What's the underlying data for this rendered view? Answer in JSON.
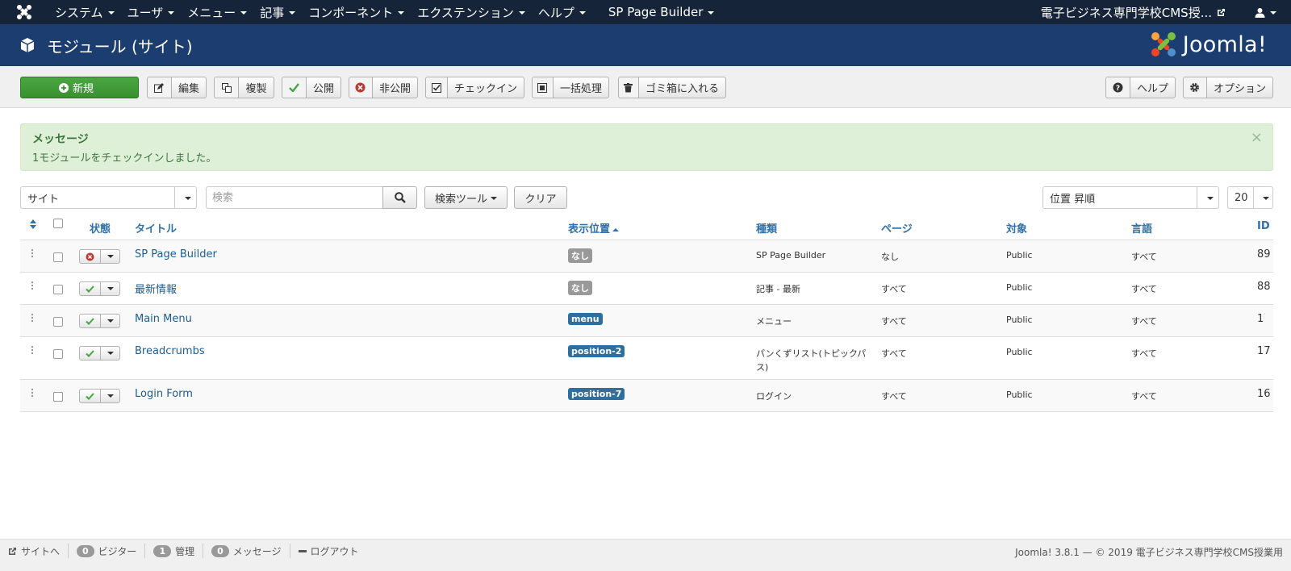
{
  "navbar": {
    "menu": [
      "システム",
      "ユーザ",
      "メニュー",
      "記事",
      "コンポーネント",
      "エクステンション",
      "ヘルプ",
      "SP Page Builder"
    ],
    "site_name": "電子ビジネス専門学校CMS授...",
    "icons": {
      "logo": "joomla-logo-icon",
      "external": "external-link-icon",
      "user": "user-icon"
    }
  },
  "header": {
    "title": "モジュール (サイト)",
    "logo_text": "Joomla!",
    "icons": {
      "title": "cube-icon"
    }
  },
  "toolbar": {
    "new_label": "新規",
    "edit_label": "編集",
    "copy_label": "複製",
    "publish_label": "公開",
    "unpublish_label": "非公開",
    "checkin_label": "チェックイン",
    "batch_label": "一括処理",
    "trash_label": "ゴミ箱に入れる",
    "help_label": "ヘルプ",
    "options_label": "オプション"
  },
  "alert": {
    "heading": "メッセージ",
    "message": "1モジュールをチェックインしました。",
    "close": "×"
  },
  "filters": {
    "client": "サイト",
    "search_placeholder": "検索",
    "search_tools_label": "検索ツール",
    "clear_label": "クリア",
    "ordering": "位置 昇順",
    "limit": "20"
  },
  "table": {
    "headers": {
      "status": "状態",
      "title": "タイトル",
      "position": "表示位置",
      "type": "種類",
      "pages": "ページ",
      "access": "対象",
      "language": "言語",
      "id": "ID"
    },
    "rows": [
      {
        "title": "SP Page Builder",
        "position": "なし",
        "position_style": "none",
        "type": "SP Page Builder",
        "pages": "なし",
        "access": "Public",
        "language": "すべて",
        "id": "89",
        "status": "unpublished"
      },
      {
        "title": "最新情報",
        "position": "なし",
        "position_style": "none",
        "type": "記事 - 最新",
        "pages": "すべて",
        "access": "Public",
        "language": "すべて",
        "id": "88",
        "status": "published"
      },
      {
        "title": "Main Menu",
        "position": "menu",
        "position_style": "info",
        "type": "メニュー",
        "pages": "すべて",
        "access": "Public",
        "language": "すべて",
        "id": "1",
        "status": "published"
      },
      {
        "title": "Breadcrumbs",
        "position": "position-2",
        "position_style": "info",
        "type_line1": "パンくずリスト(トピックパ",
        "type_line2": "ス)",
        "pages": "すべて",
        "access": "Public",
        "language": "すべて",
        "id": "17",
        "status": "published"
      },
      {
        "title": "Login Form",
        "position": "position-7",
        "position_style": "info",
        "type": "ログイン",
        "pages": "すべて",
        "access": "Public",
        "language": "すべて",
        "id": "16",
        "status": "published"
      }
    ]
  },
  "footer": {
    "view_site": "サイトへ",
    "visitors_count": "0",
    "visitors_label": "ビジター",
    "admins_count": "1",
    "admins_label": "管理",
    "messages_count": "0",
    "messages_label": "メッセージ",
    "logout_label": "ログアウト",
    "copyright": "Joomla! 3.8.1 — © 2019 電子ビジネス専門学校CMS授業用"
  },
  "colors": {
    "navbar": "#16243a",
    "header": "#1c3d6f",
    "new_button": "#46a546",
    "alert_bg": "#dff0d8",
    "link": "#1f5d8f",
    "badge_info": "#2f6fa0",
    "published": "#46a546",
    "unpublished": "#bd362f"
  }
}
